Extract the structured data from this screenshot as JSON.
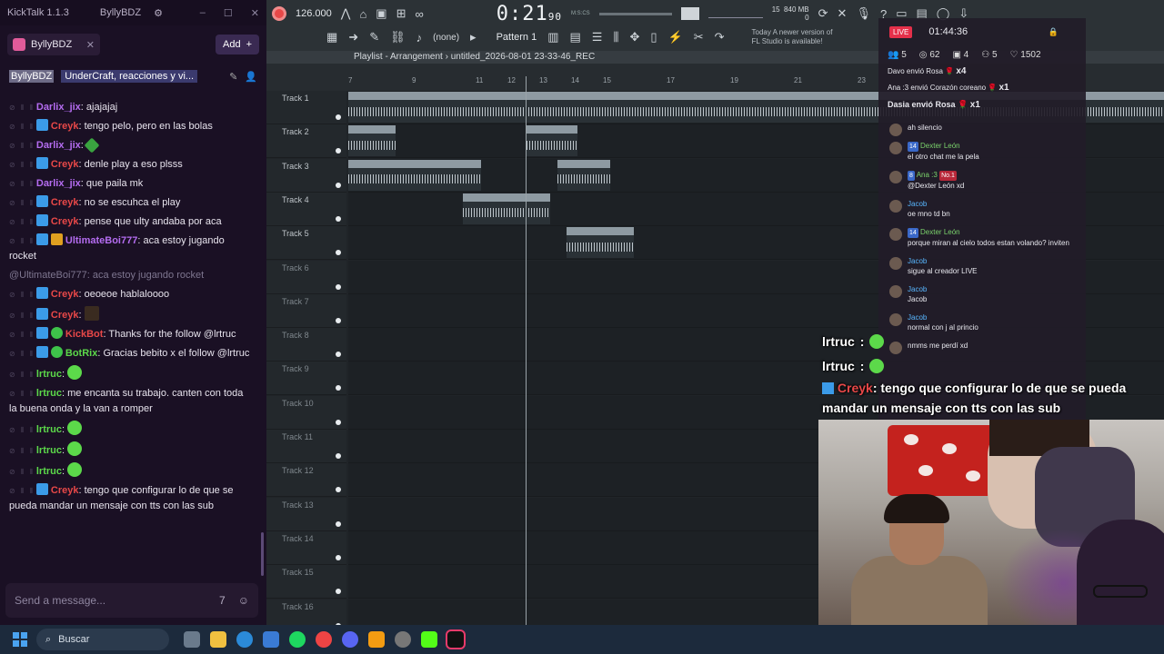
{
  "kicktalk": {
    "title": "KickTalk 1.1.3",
    "user": "ByllyBDZ",
    "tab_label": "ByllyBDZ",
    "add_label": "Add",
    "channel": "ByllyBDZ",
    "stream_title": "UnderCraft, reacciones y vi...",
    "input_placeholder": "Send a message...",
    "messages": [
      {
        "user": "Darlix_jix",
        "sep": ": ",
        "text": "ajajajaj",
        "color": "#b46cf0"
      },
      {
        "user": "Creyk",
        "sep": ": ",
        "text": "tengo pelo, pero en las bolas",
        "color": "#e84848"
      },
      {
        "user": "Darlix_jix",
        "sep": ": ",
        "text": "",
        "color": "#b46cf0"
      },
      {
        "user": "Creyk",
        "sep": ": ",
        "text": "denle play a eso plsss",
        "color": "#e84848"
      },
      {
        "user": "Darlix_jix",
        "sep": ": ",
        "text": "que paila mk",
        "color": "#b46cf0"
      },
      {
        "user": "Creyk",
        "sep": ": ",
        "text": "no se escuhca el play",
        "color": "#e84848"
      },
      {
        "user": "Creyk",
        "sep": ": ",
        "text": "pense que ulty andaba por aca",
        "color": "#e84848"
      },
      {
        "user": "UltimateBoi777",
        "sep": ": ",
        "text": "aca estoy jugando rocket",
        "color": "#b46cf0"
      },
      {
        "user": "Creyk",
        "sep": ": ",
        "text": "oeoeoe hablaloooo",
        "color": "#e84848"
      },
      {
        "user": "Creyk",
        "sep": ": ",
        "text": "",
        "color": "#e84848"
      },
      {
        "user": "KickBot",
        "sep": ": ",
        "text": "Thanks for the follow @lrtruc",
        "color": "#e84848"
      },
      {
        "user": "BotRix",
        "sep": ": ",
        "text": "Gracias bebito x el follow @lrtruc",
        "color": "#5cd94a"
      },
      {
        "user": "lrtruc",
        "sep": ": ",
        "text": "",
        "color": "#5cd94a"
      },
      {
        "user": "lrtruc",
        "sep": ": ",
        "text": "me encanta su trabajo. canten con toda la buena onda y la van a romper",
        "color": "#5cd94a"
      },
      {
        "user": "lrtruc",
        "sep": ": ",
        "text": "",
        "color": "#5cd94a"
      },
      {
        "user": "lrtruc",
        "sep": ": ",
        "text": "",
        "color": "#5cd94a"
      },
      {
        "user": "lrtruc",
        "sep": ": ",
        "text": "",
        "color": "#5cd94a"
      },
      {
        "user": "Creyk",
        "sep": ": ",
        "text": "tengo que configurar lo de que se pueda mandar un mensaje con tts con las sub",
        "color": "#e84848"
      }
    ],
    "reply_text": "@UltimateBoi777: aca estoy jugando rocket"
  },
  "fl": {
    "tempo": "126.000",
    "time": "0:21",
    "time_frac": "90",
    "time_unit": "M:S:CS",
    "mem": "840 MB",
    "cpu_val": "15",
    "cpu_zero": "0",
    "pattern": "Pattern 1",
    "none_label": "(none)",
    "news_line1": "Today  A newer version of",
    "news_line2": "FL Studio is available!",
    "playlist_title": "Playlist - Arrangement",
    "project_name": "untitled_2026-08-01 23-33-46_REC",
    "ruler_marks": [
      "7",
      "9",
      "11",
      "12",
      "13",
      "14",
      "15",
      "17",
      "19",
      "21",
      "23"
    ],
    "tracks": [
      "Track 1",
      "Track 2",
      "Track 3",
      "Track 4",
      "Track 5",
      "Track 6",
      "Track 7",
      "Track 8",
      "Track 9",
      "Track 10",
      "Track 11",
      "Track 12",
      "Track 13",
      "Track 14",
      "Track 15",
      "Track 16"
    ],
    "clip_labels": {
      "beat": "100 PORCENT PERCTS (BEAT)",
      "c2a": "untitl...5_REC",
      "c2b": "untitle...23_REC",
      "c3a": "untitled_2026-08-01 23-18-41_REC",
      "c3b": "untitle...47_REC",
      "c4": "untitled_2026...3-24-27_REC",
      "c5": "untitled_2...3-46_REC"
    }
  },
  "overlay": {
    "live": "LIVE",
    "uptime": "01:44:36",
    "stats": [
      "5",
      "62",
      "4",
      "5",
      "1502"
    ],
    "events": [
      {
        "user": "Davo",
        "text": "envió Rosa",
        "mult": "x4"
      },
      {
        "user": "Ana :3",
        "text": "envió Corazón coreano",
        "mult": "x1"
      },
      {
        "user": "Dasia",
        "text": "envió Rosa",
        "mult": "x1"
      }
    ],
    "chat": [
      {
        "user": "",
        "text": "ah silencio"
      },
      {
        "user": "Dexter León",
        "lvl": "14",
        "text": "el otro chat me la pela"
      },
      {
        "user": "Ana :3",
        "lvl": "8",
        "no1": "No.1",
        "text": "@Dexter León xd"
      },
      {
        "user": "Jacob",
        "text": "oe mno td bn"
      },
      {
        "user": "Dexter León",
        "lvl": "14",
        "text": "porque miran al cielo todos estan volando? inviten"
      },
      {
        "user": "Jacob",
        "text": "sigue al creador LIVE"
      },
      {
        "user": "Jacob",
        "text": "Jacob"
      },
      {
        "user": "Jacob",
        "text": "normal con j al princio"
      },
      {
        "user": "",
        "text": "nmms me perdí xd"
      }
    ]
  },
  "onscreen_chat": {
    "line1_user": "lrtruc",
    "line2_user": "lrtruc",
    "big_user": "Creyk",
    "big_text": ": tengo que configurar lo de que se pueda mandar un mensaje con tts con las sub"
  },
  "taskbar": {
    "search_label": "Buscar"
  }
}
